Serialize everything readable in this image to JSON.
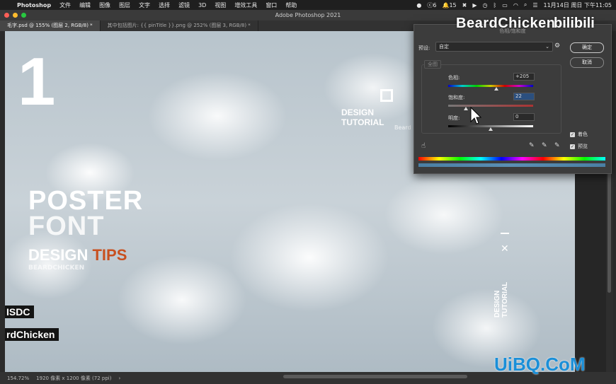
{
  "menubar": {
    "apple": "",
    "items": [
      "Photoshop",
      "文件",
      "编辑",
      "图像",
      "图层",
      "文字",
      "选择",
      "滤镜",
      "3D",
      "视图",
      "增效工具",
      "窗口",
      "帮助"
    ],
    "status_c": "6",
    "status_bell": "15",
    "datetime": "11月14日 周日 下午11:05"
  },
  "window": {
    "title": "Adobe Photoshop 2021"
  },
  "tabs": [
    {
      "label": "毛字.psd @ 155% (图层 2, RGB/8) *"
    },
    {
      "label": "其中包括图片: {{ pinTitle }}.png @ 252% (图层 3, RGB/8) *"
    }
  ],
  "canvas": {
    "big_number": "1",
    "poster_line1": "POSTER",
    "poster_line2": "FONT",
    "design": "DESIGN",
    "tips": "TIPS",
    "sub": "BEARDCHICKEN",
    "design_tut1": "DESIGN",
    "design_tut2": "TUTORIAL",
    "beard_faint": "Beard",
    "vert1": "DESIGN",
    "vert2": "TUTORIAL",
    "label_sdc": "ISDC",
    "label_rd": "rdChicken",
    "xmark": "✕"
  },
  "status": {
    "zoom": "154.72%",
    "doc_info": "1920 像素 x 1200 像素 (72 ppi)",
    "arrow": "›"
  },
  "dialog": {
    "title": "色相/饱和度",
    "preset_label": "预设:",
    "preset_value": "自定",
    "channel": "全图",
    "ok": "确定",
    "cancel": "取消",
    "hue_label": "色相:",
    "hue_value": "+205",
    "hue_fraction": 0.57,
    "sat_label": "饱和度:",
    "sat_value": "22",
    "sat_fraction": 0.21,
    "light_label": "明度:",
    "light_value": "0",
    "light_fraction": 0.5,
    "colorize_label": "着色",
    "preview_label": "预览"
  },
  "overlay": {
    "watermark": "BeardChicken",
    "bili": "bilibili",
    "uibq": "UiBQ.CoM"
  }
}
